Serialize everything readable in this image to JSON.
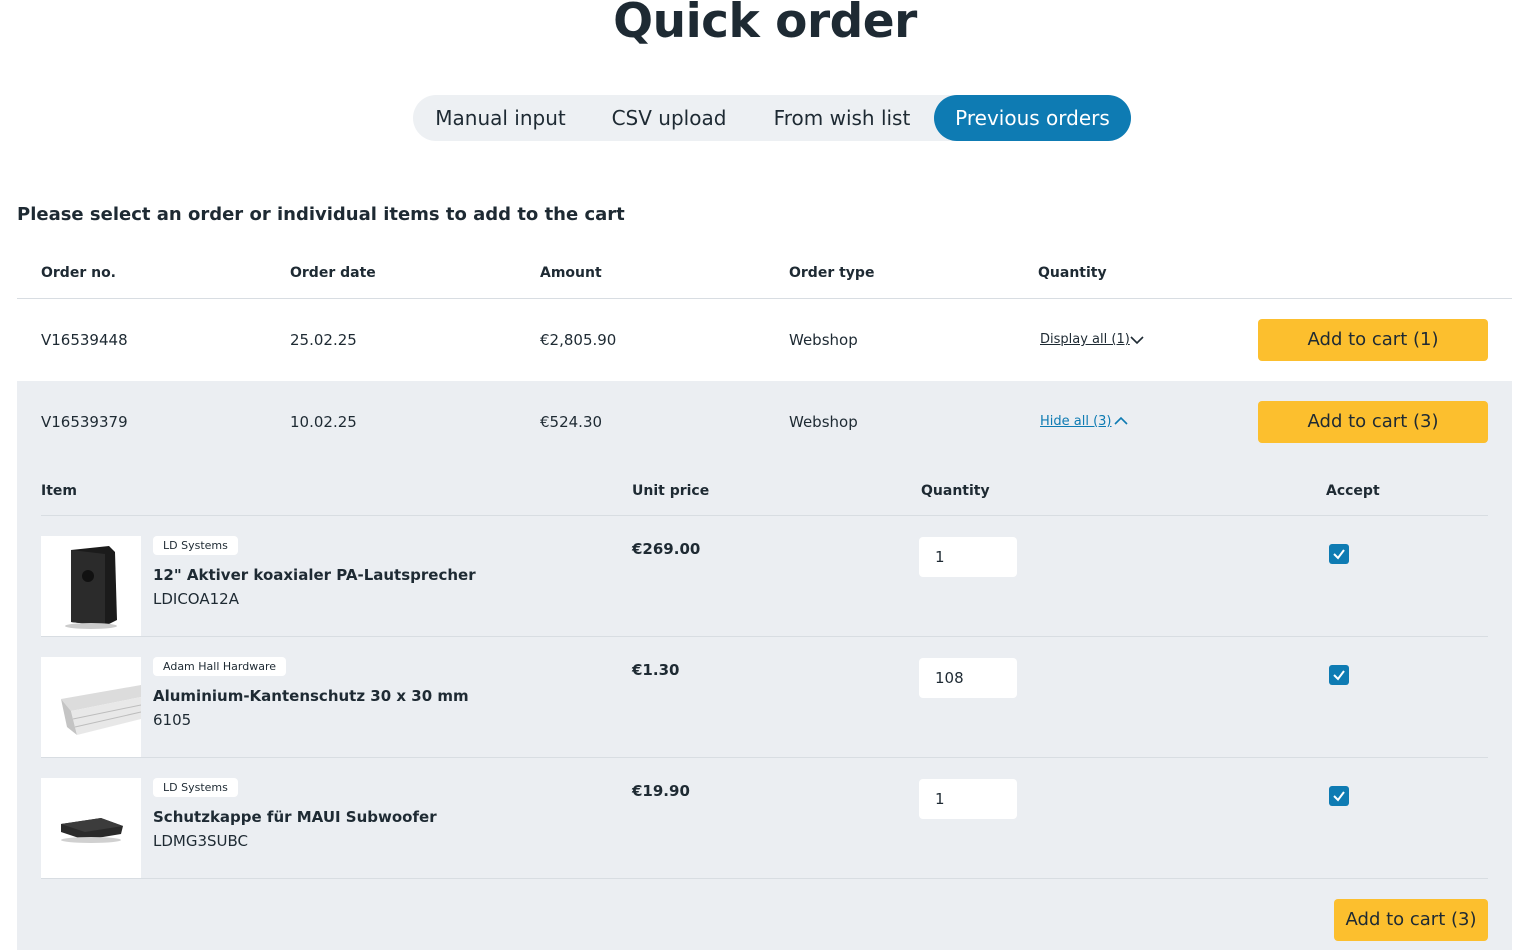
{
  "page": {
    "title": "Quick order"
  },
  "tabs": [
    {
      "label": "Manual input",
      "active": false
    },
    {
      "label": "CSV upload",
      "active": false
    },
    {
      "label": "From wish list",
      "active": false
    },
    {
      "label": "Previous orders",
      "active": true
    }
  ],
  "instruction": "Please select an order or individual items to add to the cart",
  "orders_table": {
    "headers": [
      "Order no.",
      "Order date",
      "Amount",
      "Order type",
      "Quantity"
    ],
    "rows": [
      {
        "order_no": "V16539448",
        "date": "25.02.25",
        "amount": "€2,805.90",
        "type": "Webshop",
        "toggle": "Display all (1)",
        "expanded": false,
        "cart_label": "Add to cart (1)"
      },
      {
        "order_no": "V16539379",
        "date": "10.02.25",
        "amount": "€524.30",
        "type": "Webshop",
        "toggle": "Hide all (3)",
        "expanded": true,
        "cart_label": "Add to cart (3)"
      }
    ]
  },
  "items_table": {
    "headers": [
      "Item",
      "Unit price",
      "Quantity",
      "Accept"
    ],
    "items": [
      {
        "brand": "LD Systems",
        "name": "12\" Aktiver koaxialer PA-Lautsprecher",
        "sku": "LDICOA12A",
        "price": "€269.00",
        "quantity": "1",
        "accepted": true,
        "image": "speaker-image"
      },
      {
        "brand": "Adam Hall Hardware",
        "name": "Aluminium-Kantenschutz 30 x 30 mm",
        "sku": "6105",
        "price": "€1.30",
        "quantity": "108",
        "accepted": true,
        "image": "edge-protector-image"
      },
      {
        "brand": "LD Systems",
        "name": "Schutzkappe für MAUI Subwoofer",
        "sku": "LDMG3SUBC",
        "price": "€19.90",
        "quantity": "1",
        "accepted": true,
        "image": "subwoofer-cap-image"
      }
    ],
    "cart_label": "Add to cart (3)"
  },
  "colors": {
    "accent": "#0e7bb3",
    "cart_button": "#fcbf2e",
    "expanded_bg": "#ebeef2",
    "text": "#1e2a33"
  }
}
